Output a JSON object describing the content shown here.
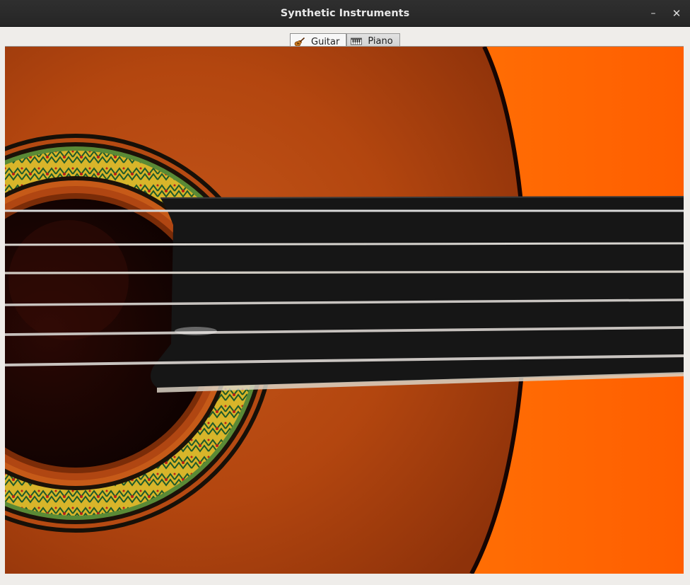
{
  "window": {
    "title": "Synthetic Instruments",
    "minimize_icon": "minimize-icon",
    "close_icon": "close-icon"
  },
  "tabs": [
    {
      "label": "Guitar",
      "icon": "guitar-icon",
      "selected": true
    },
    {
      "label": "Piano",
      "icon": "piano-icon",
      "selected": false
    }
  ],
  "colors": {
    "titlebar": "#2b2b2b",
    "window_bg": "#efedea",
    "guitar_top": "#b5470f",
    "background_orange": "#ff6a00",
    "fretboard": "#161616"
  }
}
